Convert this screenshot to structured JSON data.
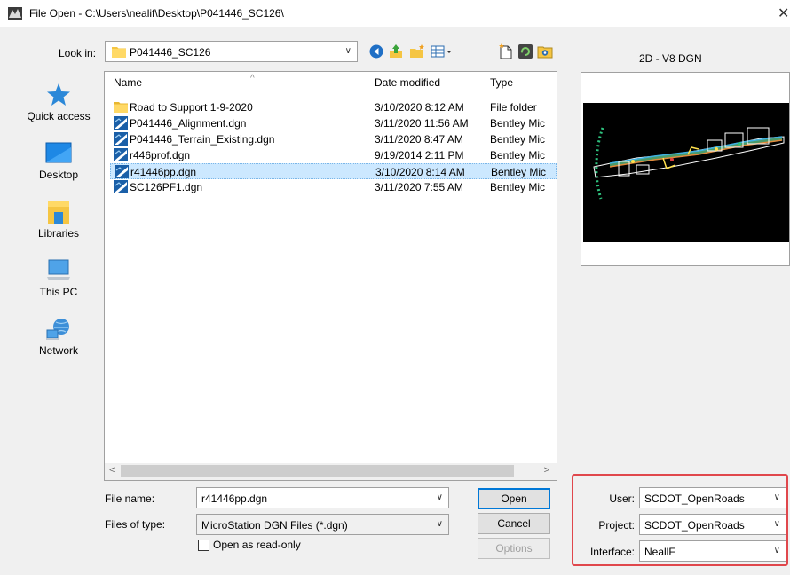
{
  "window": {
    "title": "File Open - C:\\Users\\nealif\\Desktop\\P041446_SC126\\",
    "close_glyph": "✕"
  },
  "lookin": {
    "label": "Look in:",
    "value": "P041446_SC126"
  },
  "toolbar": {
    "icons": [
      "back-icon",
      "up-folder-icon",
      "new-folder-icon",
      "view-menu-icon",
      "new-file-icon",
      "refresh-icon",
      "favorite-icon"
    ]
  },
  "preview": {
    "label": "2D - V8 DGN"
  },
  "places": [
    {
      "label": "Quick access",
      "icon": "quick-access-icon"
    },
    {
      "label": "Desktop",
      "icon": "desktop-icon"
    },
    {
      "label": "Libraries",
      "icon": "libraries-icon"
    },
    {
      "label": "This PC",
      "icon": "this-pc-icon"
    },
    {
      "label": "Network",
      "icon": "network-icon"
    }
  ],
  "filelist": {
    "columns": {
      "name": "Name",
      "date": "Date modified",
      "type": "Type"
    },
    "rows": [
      {
        "name": "Road to Support 1-9-2020",
        "date": "3/10/2020 8:12 AM",
        "type": "File folder",
        "icon": "folder-icon",
        "selected": false
      },
      {
        "name": "P041446_Alignment.dgn",
        "date": "3/11/2020 11:56 AM",
        "type": "Bentley Mic",
        "icon": "dgn-file-icon",
        "selected": false
      },
      {
        "name": "P041446_Terrain_Existing.dgn",
        "date": "3/11/2020 8:47 AM",
        "type": "Bentley Mic",
        "icon": "dgn-file-icon",
        "selected": false
      },
      {
        "name": "r446prof.dgn",
        "date": "9/19/2014 2:11 PM",
        "type": "Bentley Mic",
        "icon": "dgn-file-icon",
        "selected": false
      },
      {
        "name": "r41446pp.dgn",
        "date": "3/10/2020 8:14 AM",
        "type": "Bentley Mic",
        "icon": "dgn-file-icon",
        "selected": true
      },
      {
        "name": "SC126PF1.dgn",
        "date": "3/11/2020 7:55 AM",
        "type": "Bentley Mic",
        "icon": "dgn-file-icon",
        "selected": false
      }
    ]
  },
  "form": {
    "file_name_label": "File name:",
    "file_name_value": "r41446pp.dgn",
    "file_type_label": "Files of type:",
    "file_type_value": "MicroStation DGN Files (*.dgn)",
    "read_only_label": "Open as read-only",
    "read_only_checked": false
  },
  "buttons": {
    "open": "Open",
    "cancel": "Cancel",
    "options": "Options"
  },
  "config": {
    "user_label": "User:",
    "user_value": "SCDOT_OpenRoads",
    "project_label": "Project:",
    "project_value": "SCDOT_OpenRoads",
    "interface_label": "Interface:",
    "interface_value": "NeallF"
  },
  "colors": {
    "accent": "#0078d7",
    "selection": "#cce8ff",
    "highlight_box": "#e0474c"
  }
}
